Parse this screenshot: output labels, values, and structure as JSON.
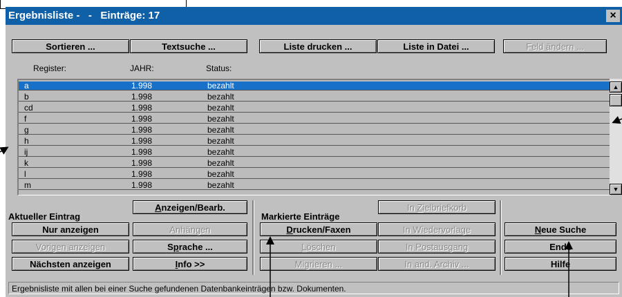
{
  "window": {
    "title": "Ergebnisliste -   -   Einträge: 17",
    "close_label": "×"
  },
  "toolbar": {
    "sortieren": "Sortieren ...",
    "textsuche": "Textsuche ...",
    "liste_drucken": "Liste drucken ...",
    "liste_in_datei": "Liste in Datei ...",
    "feld_aendern": "Feld ändern ..."
  },
  "columns": [
    "Register:",
    "JAHR:",
    "Status:"
  ],
  "rows": [
    {
      "register": "a",
      "jahr": "1.998",
      "status": "bezahlt",
      "selected": true
    },
    {
      "register": "b",
      "jahr": "1.998",
      "status": "bezahlt"
    },
    {
      "register": "cd",
      "jahr": "1.998",
      "status": "bezahlt"
    },
    {
      "register": "f",
      "jahr": "1.998",
      "status": "bezahlt"
    },
    {
      "register": "g",
      "jahr": "1.998",
      "status": "bezahlt"
    },
    {
      "register": "h",
      "jahr": "1.998",
      "status": "bezahlt"
    },
    {
      "register": "ij",
      "jahr": "1.998",
      "status": "bezahlt"
    },
    {
      "register": "k",
      "jahr": "1.998",
      "status": "bezahlt"
    },
    {
      "register": "l",
      "jahr": "1.998",
      "status": "bezahlt"
    },
    {
      "register": "m",
      "jahr": "1.998",
      "status": "bezahlt"
    }
  ],
  "aktueller": {
    "label": "Aktueller Eintrag",
    "anzeigen_bearb": {
      "u": "A",
      "rest": "nzeigen/Bearb."
    },
    "nur_anzeigen": "Nur anzeigen",
    "anhaengen": "Anhängen",
    "vorigen_anzeigen": "Vorigen anzeigen",
    "sprache": {
      "pre": "S",
      "u": "p",
      "rest": "rache ..."
    },
    "naechsten_anzeigen": "Nächsten anzeigen",
    "info": {
      "u": "I",
      "rest": "nfo >>"
    }
  },
  "markierte": {
    "label": "Markierte Einträge",
    "in_zielbriefkorb": {
      "pre": "In ",
      "u": "Z",
      "rest": "ielbriefkorb"
    },
    "drucken_faxen": {
      "u": "D",
      "rest": "rucken/Faxen"
    },
    "in_wiedervorlage": "In Wiedervorlage",
    "loeschen": {
      "u": "L",
      "rest": "öschen"
    },
    "in_postausgang": "In Postausgang",
    "migrieren": "Migrieren ...",
    "in_and_archiv": "In and. Archiv ..."
  },
  "right": {
    "neue_suche": {
      "u": "N",
      "rest": "eue Suche"
    },
    "ende": {
      "pre": "En",
      "rest": "de"
    },
    "hilfe": {
      "pre": "Hi",
      "rest": "lfe"
    }
  },
  "status_text": "Ergebnisliste mit allen bei einer Suche gefundenen Datenbankeinträgen bzw. Dokumenten."
}
